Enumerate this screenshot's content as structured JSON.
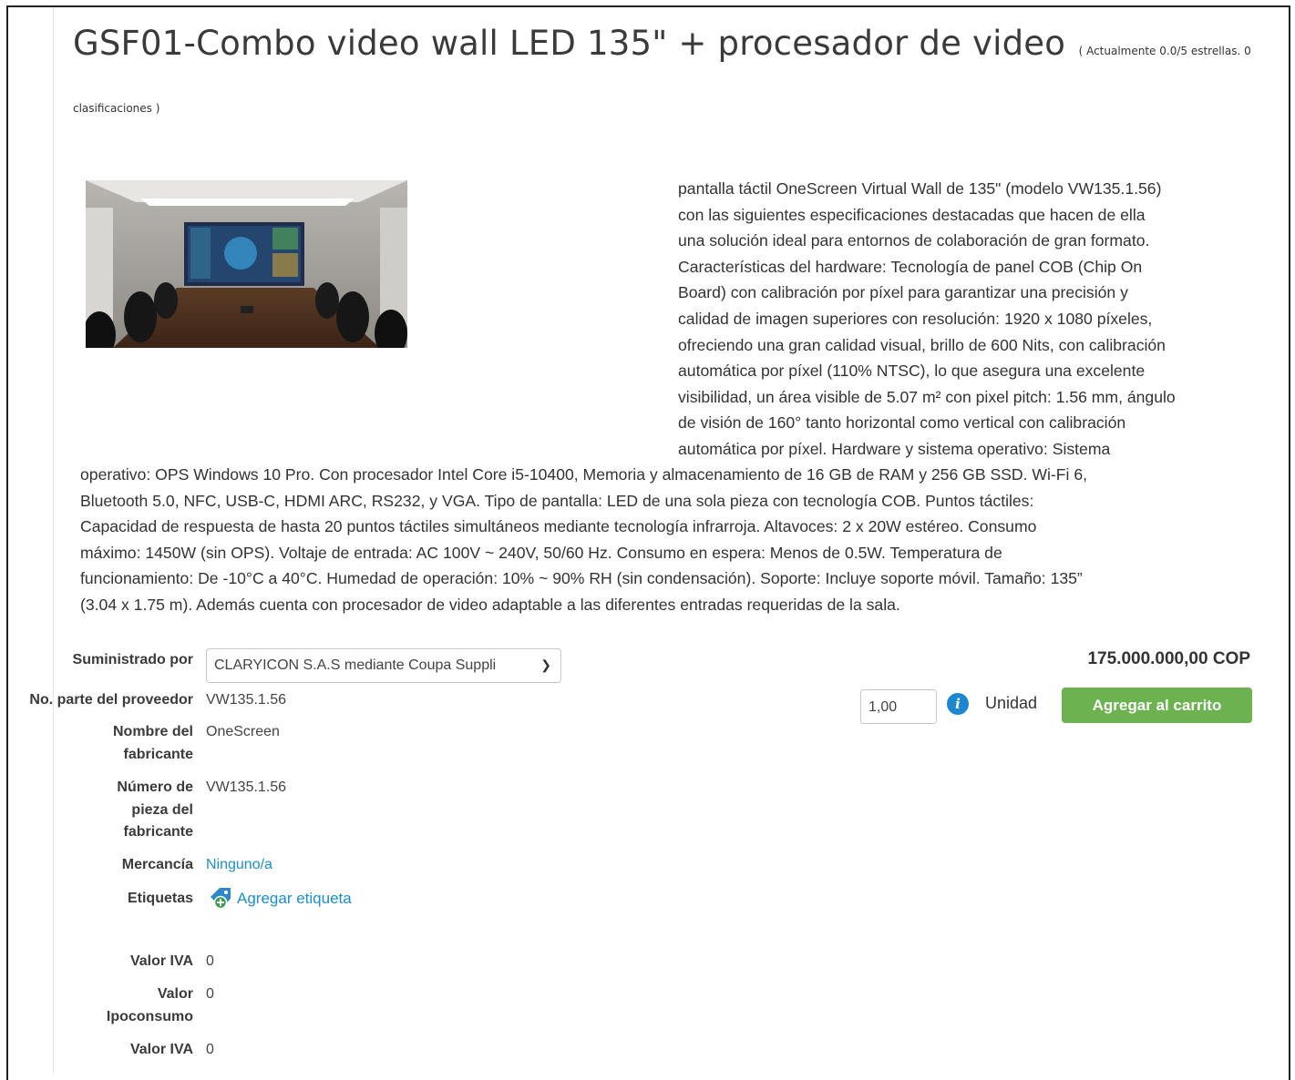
{
  "product": {
    "title": "GSF01-Combo video wall LED 135\" + procesador de video",
    "rating_part1": "( Actualmente 0.0/5 estrellas. 0",
    "rating_part2": "clasificaciones )",
    "image_icon": "conference-room-photo",
    "description_right": [
      "pantalla táctil OneScreen Virtual Wall de 135\" (modelo VW135.1.56)",
      "con las siguientes especificaciones destacadas que hacen de ella",
      "una solución ideal para entornos de colaboración de gran formato.",
      "Características del hardware: Tecnología de panel COB (Chip On",
      "Board) con calibración por píxel para garantizar una precisión y",
      "calidad de imagen superiores con resolución: 1920 x 1080 píxeles,",
      "ofreciendo una gran calidad visual, brillo de 600 Nits, con calibración",
      "automática por píxel (110% NTSC), lo que asegura una excelente",
      "visibilidad, un área visible de 5.07 m² con pixel pitch: 1.56 mm, ángulo",
      "de visión de 160° tanto horizontal como vertical con calibración",
      "automática por píxel. Hardware y sistema operativo: Sistema"
    ],
    "description_full": [
      "operativo: OPS Windows 10 Pro. Con procesador Intel Core i5-10400, Memoria y almacenamiento de 16 GB de RAM y 256 GB SSD. Wi-Fi 6,",
      "Bluetooth 5.0, NFC, USB-C, HDMI ARC, RS232, y VGA. Tipo de pantalla: LED de una sola pieza con tecnología COB. Puntos táctiles:",
      "Capacidad de respuesta de hasta 20 puntos táctiles simultáneos mediante tecnología infrarroja. Altavoces: 2 x 20W estéreo. Consumo",
      "máximo: 1450W (sin OPS). Voltaje de entrada: AC 100V ~ 240V, 50/60 Hz. Consumo en espera: Menos de 0.5W. Temperatura de",
      "funcionamiento: De -10°C a 40°C. Humedad de operación: 10% ~ 90% RH (sin condensación). Soporte: Incluye soporte móvil. Tamaño: 135”",
      "(3.04 x 1.75 m). Además cuenta con procesador de video adaptable a las diferentes entradas requeridas de la sala."
    ]
  },
  "purchase": {
    "supplier_label": "Suministrado por",
    "supplier_value": "CLARYICON S.A.S mediante Coupa Suppli",
    "price": "175.000.000,00 COP",
    "quantity": "1,00",
    "unit": "Unidad",
    "add_to_cart": "Agregar al carrito"
  },
  "fields": {
    "supplier_part_label": "No. parte del proveedor",
    "supplier_part_value": "VW135.1.56",
    "manufacturer_label_1": "Nombre del",
    "manufacturer_label_2": "fabricante",
    "manufacturer_value": "OneScreen",
    "mfr_part_label_1": "Número de",
    "mfr_part_label_2": "pieza del",
    "mfr_part_label_3": "fabricante",
    "mfr_part_value": "VW135.1.56",
    "commodity_label": "Mercancía",
    "commodity_value": "Ninguno/a",
    "tags_label": "Etiquetas",
    "tags_link": "Agregar etiqueta",
    "iva_label": "Valor IVA",
    "iva_value": "0",
    "ipoconsumo_label_1": "Valor",
    "ipoconsumo_label_2": "Ipoconsumo",
    "ipoconsumo_value": "0",
    "iva2_label": "Valor IVA",
    "iva2_value": "0"
  },
  "colors": {
    "link": "#1a8fd0",
    "button_green": "#6cb250",
    "info_blue": "#1c86d1"
  }
}
